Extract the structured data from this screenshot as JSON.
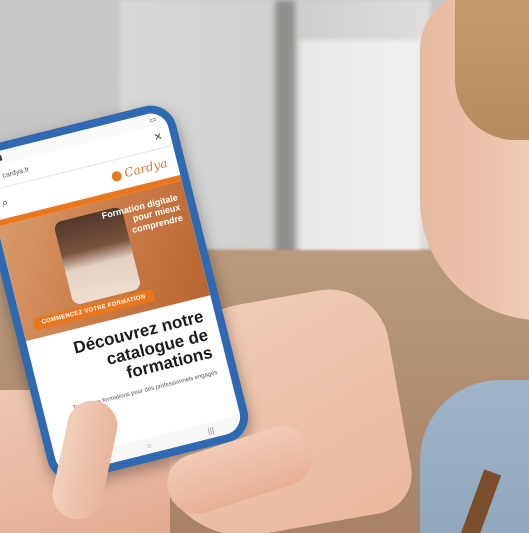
{
  "browser": {
    "url": "cardya.fr",
    "back_glyph": "‹",
    "close_glyph": "✕"
  },
  "site": {
    "logo_text": "Cardya"
  },
  "hero": {
    "title": "Formation digitale pour mieux comprendre",
    "cta": "COMMENCEZ VOTRE FORMATION"
  },
  "main": {
    "headline": "Découvrez notre catalogue de formations",
    "body": "Toutes nos formations pour des professionnels engagés"
  },
  "nav": {
    "back": "<",
    "home": "○",
    "menu": "|||"
  },
  "colors": {
    "accent": "#e9771e",
    "phone_case": "#2f69b1"
  }
}
